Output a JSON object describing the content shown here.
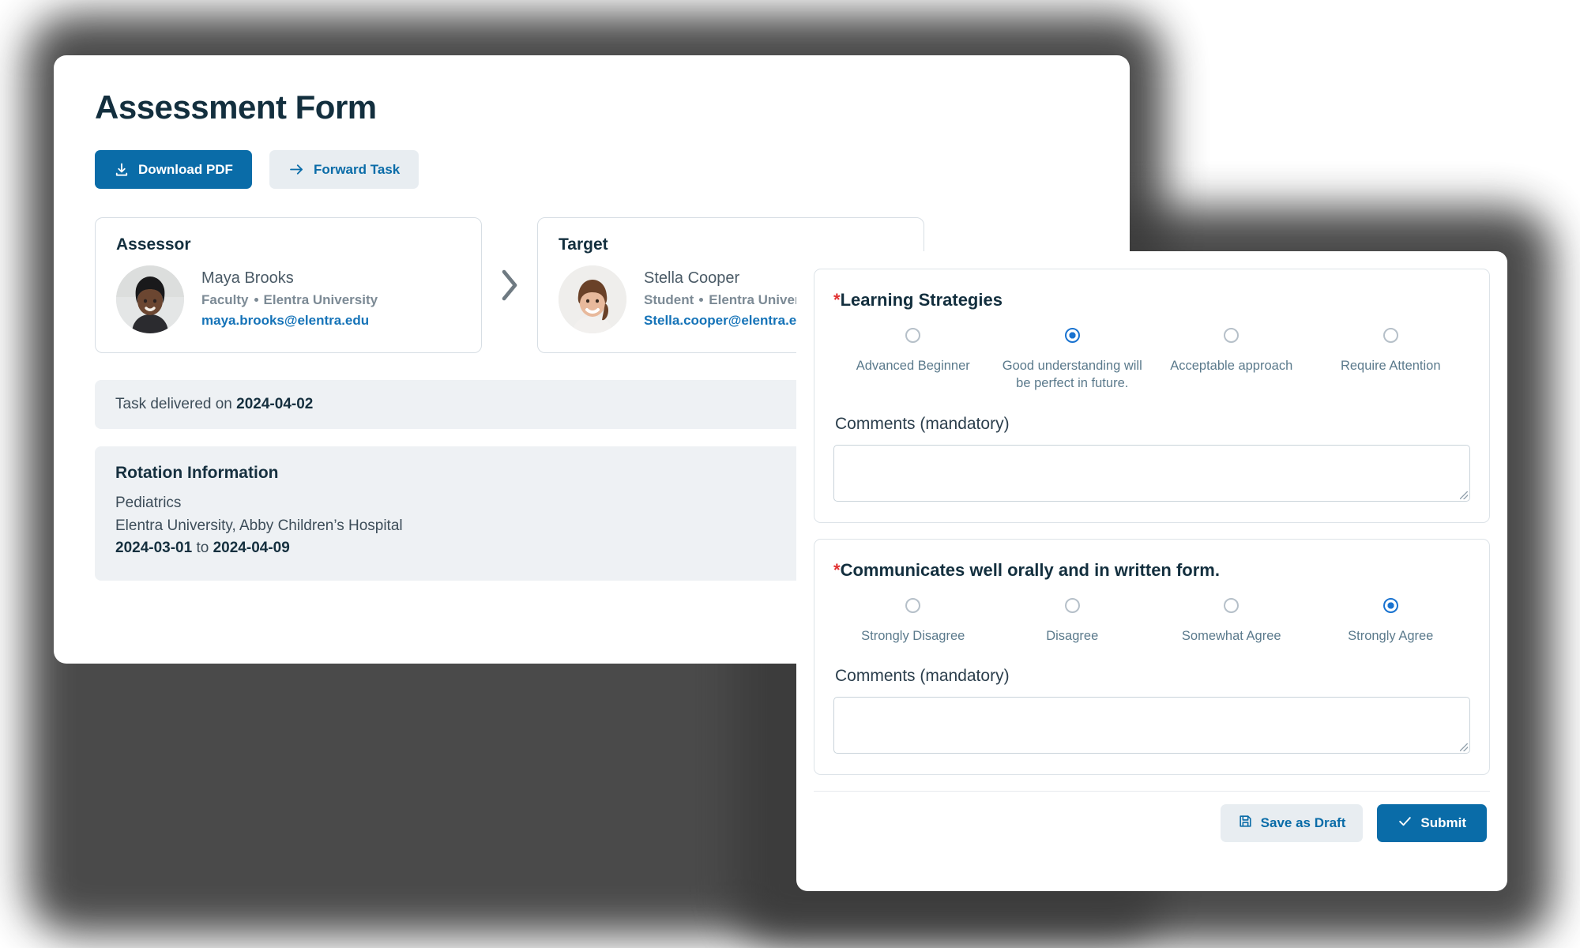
{
  "header": {
    "title": "Assessment Form"
  },
  "toolbar": {
    "download_label": "Download PDF",
    "forward_label": "Forward Task"
  },
  "assessor": {
    "card_title": "Assessor",
    "name": "Maya Brooks",
    "role": "Faculty",
    "org": "Elentra University",
    "email": "maya.brooks@elentra.edu"
  },
  "target": {
    "card_title": "Target",
    "name": "Stella Cooper",
    "role": "Student",
    "org": "Elentra University",
    "email": "Stella.cooper@elentra.edu"
  },
  "delivery": {
    "prefix": "Task delivered on ",
    "date": "2024-04-02"
  },
  "rotation": {
    "title": "Rotation Information",
    "discipline": "Pediatrics",
    "site": "Elentra University, Abby Children’s Hospital",
    "start_date": "2024-03-01",
    "range_join": " to ",
    "end_date": "2024-04-09"
  },
  "form": {
    "required_marker": "*",
    "questions": [
      {
        "title": "Learning Strategies",
        "options": [
          "Advanced Beginner",
          "Good understanding will be perfect in future.",
          "Acceptable approach",
          "Require Attention"
        ],
        "selected_index": 1,
        "comments_label": "Comments (mandatory)",
        "comments_value": ""
      },
      {
        "title": "Communicates well orally and in written form.",
        "options": [
          "Strongly Disagree",
          "Disagree",
          "Somewhat Agree",
          "Strongly Agree"
        ],
        "selected_index": 3,
        "comments_label": "Comments (mandatory)",
        "comments_value": ""
      }
    ],
    "save_draft_label": "Save as Draft",
    "submit_label": "Submit"
  },
  "colors": {
    "primary": "#0a6ca8",
    "secondary_bg": "#e8edf1",
    "link": "#1573b8",
    "required": "#e03131",
    "radio_selected": "#1a73d0",
    "title": "#132f3e",
    "strip_bg": "#eef1f4"
  }
}
